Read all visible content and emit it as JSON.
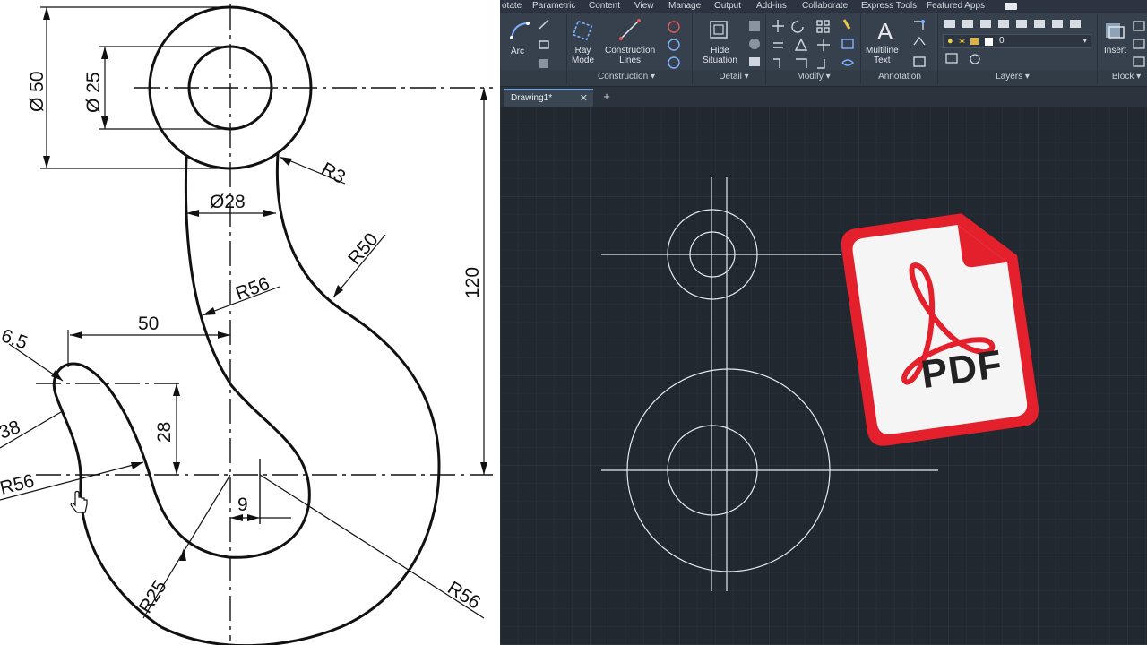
{
  "drawing": {
    "dimensions": {
      "d50": "Ø 50",
      "d25": "Ø 25",
      "r3": "R3",
      "d28": "Ø28",
      "r50": "R50",
      "v120": "120",
      "r56_shank": "R56",
      "h50": "50",
      "r6_5": "6.5",
      "v28": "28",
      "r38": "38",
      "r56_left": "R56",
      "h9": "9",
      "r25": "R25",
      "r56_bottom": "R56"
    }
  },
  "cad": {
    "tabs": [
      "otate",
      "Parametric",
      "Content",
      "View",
      "Manage",
      "Output",
      "Add-ins",
      "Collaborate",
      "Express Tools",
      "Featured Apps"
    ],
    "buttons": {
      "arc": "Arc",
      "ray_mode": [
        "Ray",
        "Mode"
      ],
      "construction_lines": [
        "Construction",
        "Lines"
      ],
      "hide_situation": [
        "Hide",
        "Situation"
      ],
      "multiline_text": [
        "Multiline",
        "Text"
      ],
      "insert": "Insert"
    },
    "panels": {
      "construction": "Construction ▾",
      "detail": "Detail ▾",
      "modify": "Modify ▾",
      "annotation": "Annotation",
      "layers": "Layers ▾",
      "block": "Block ▾"
    },
    "layer_value": "0",
    "document_tab": "Drawing1*",
    "close_glyph": "✕",
    "new_tab_glyph": "+",
    "colors": {
      "canvas": "#212830",
      "ribbon": "#37414d",
      "geometry": "#e6e9ed"
    }
  },
  "overlay": {
    "pdf_label": "PDF",
    "pdf_accent": "#e3202b"
  }
}
